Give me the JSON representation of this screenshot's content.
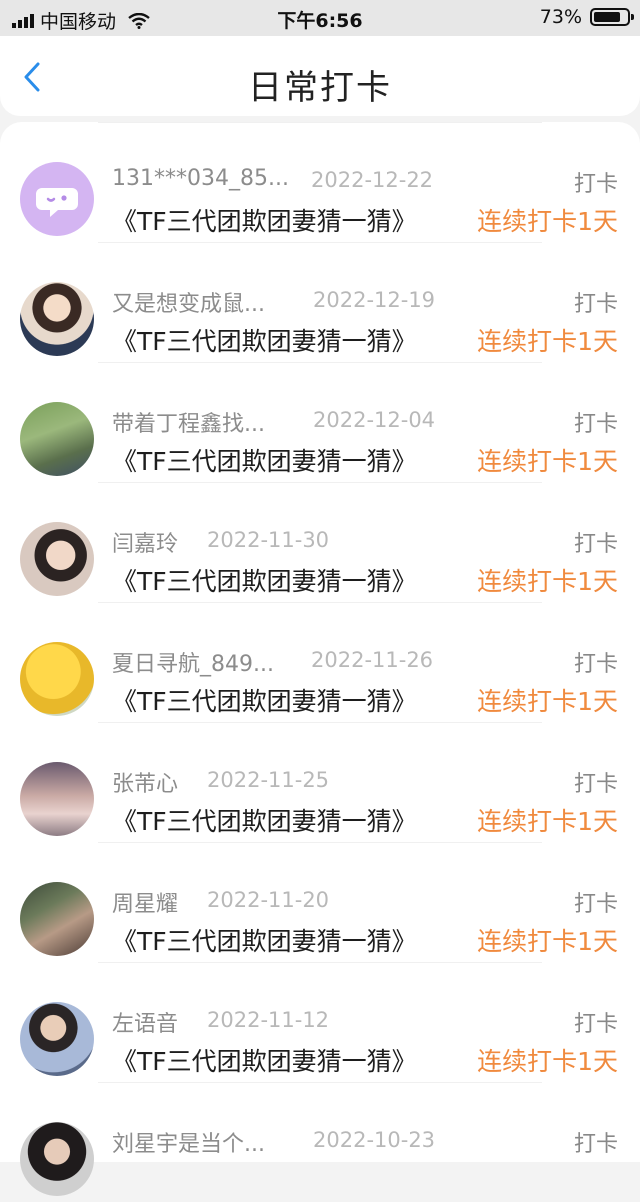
{
  "status_bar": {
    "carrier": "中国移动",
    "time": "下午6:56",
    "battery": "73%"
  },
  "nav": {
    "title": "日常打卡"
  },
  "colors": {
    "accent": "#2a8dea",
    "streak": "#f08a3e"
  },
  "entries": [
    {
      "name": "131***034_85...",
      "date": "2022-12-22",
      "action": "打卡",
      "course": "《TF三代团欺团妻猜一猜》",
      "streak": "连续打卡1天",
      "avatar_icon": "chat-bubble-icon"
    },
    {
      "name": "又是想变成鼠...",
      "date": "2022-12-19",
      "action": "打卡",
      "course": "《TF三代团欺团妻猜一猜》",
      "streak": "连续打卡1天",
      "avatar_icon": "user-photo"
    },
    {
      "name": "带着丁程鑫找...",
      "date": "2022-12-04",
      "action": "打卡",
      "course": "《TF三代团欺团妻猜一猜》",
      "streak": "连续打卡1天",
      "avatar_icon": "user-photo"
    },
    {
      "name": "闫嘉玲",
      "date": "2022-11-30",
      "action": "打卡",
      "course": "《TF三代团欺团妻猜一猜》",
      "streak": "连续打卡1天",
      "avatar_icon": "user-photo"
    },
    {
      "name": "夏日寻航_849...",
      "date": "2022-11-26",
      "action": "打卡",
      "course": "《TF三代团欺团妻猜一猜》",
      "streak": "连续打卡1天",
      "avatar_icon": "user-photo"
    },
    {
      "name": "张芾心",
      "date": "2022-11-25",
      "action": "打卡",
      "course": "《TF三代团欺团妻猜一猜》",
      "streak": "连续打卡1天",
      "avatar_icon": "user-photo"
    },
    {
      "name": "周星耀",
      "date": "2022-11-20",
      "action": "打卡",
      "course": "《TF三代团欺团妻猜一猜》",
      "streak": "连续打卡1天",
      "avatar_icon": "user-photo"
    },
    {
      "name": "左语音",
      "date": "2022-11-12",
      "action": "打卡",
      "course": "《TF三代团欺团妻猜一猜》",
      "streak": "连续打卡1天",
      "avatar_icon": "user-photo"
    },
    {
      "name": "刘星宇是当个...",
      "date": "2022-10-23",
      "action": "打卡",
      "course": "",
      "streak": "",
      "avatar_icon": "user-photo"
    }
  ]
}
